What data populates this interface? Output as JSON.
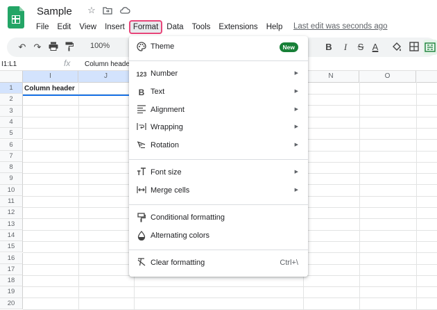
{
  "app": {
    "title": "Sample",
    "last_edit": "Last edit was seconds ago"
  },
  "menubar": [
    "File",
    "Edit",
    "View",
    "Insert",
    "Format",
    "Data",
    "Tools",
    "Extensions",
    "Help"
  ],
  "toolbar": {
    "zoom": "100%",
    "bold": "B",
    "italic": "I",
    "strike": "S",
    "text_color": "A"
  },
  "formula": {
    "namebox": "I1:L1",
    "fx": "fx",
    "content": "Column heade"
  },
  "grid": {
    "columns": [
      "I",
      "J",
      "N",
      "O"
    ],
    "rows": [
      "1",
      "2",
      "3",
      "4",
      "5",
      "6",
      "7",
      "8",
      "9",
      "10",
      "11",
      "12",
      "13",
      "14",
      "15",
      "16",
      "17",
      "18",
      "19",
      "20"
    ],
    "cell_a1": "Column header"
  },
  "format_menu": {
    "theme": {
      "label": "Theme",
      "badge": "New"
    },
    "number": "Number",
    "text": "Text",
    "alignment": "Alignment",
    "wrapping": "Wrapping",
    "rotation": "Rotation",
    "font_size": "Font size",
    "merge_cells": "Merge cells",
    "conditional_formatting": "Conditional formatting",
    "alternating_colors": "Alternating colors",
    "clear_formatting": {
      "label": "Clear formatting",
      "shortcut": "Ctrl+\\"
    }
  },
  "icons": {
    "number": "123",
    "text": "B"
  }
}
